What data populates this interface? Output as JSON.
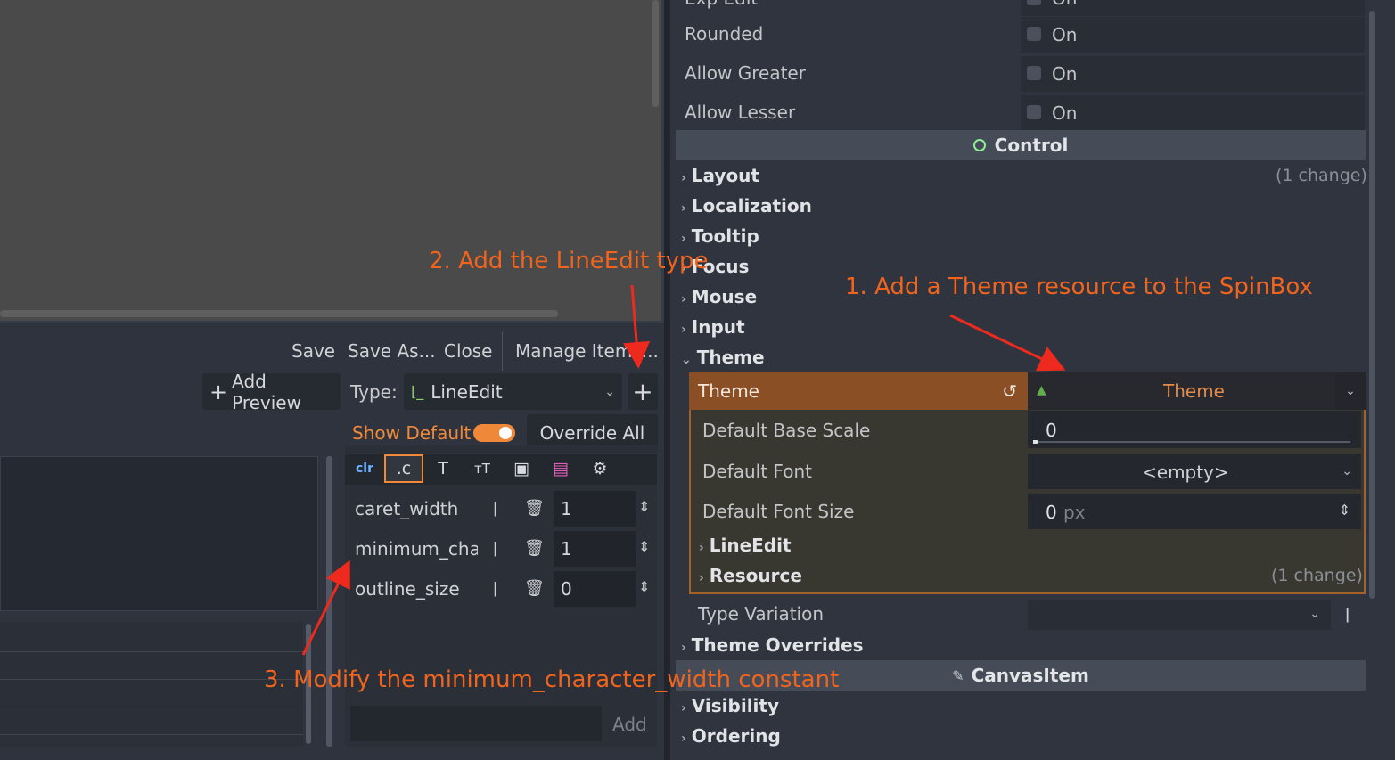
{
  "theme_editor": {
    "menu": {
      "save": "Save",
      "save_as": "Save As...",
      "close": "Close",
      "manage_items": "Manage Items..."
    },
    "add_preview": "Add Preview",
    "type_label": "Type:",
    "type_value": "LineEdit",
    "show_default": "Show Default",
    "override_all": "Override All",
    "constants": [
      {
        "name": "caret_width",
        "value": "1"
      },
      {
        "name": "minimum_char",
        "value": "1"
      },
      {
        "name": "outline_size",
        "value": "0"
      }
    ],
    "add_button": "Add"
  },
  "inspector": {
    "props_top": [
      {
        "label": "Exp Edit",
        "value": "On"
      },
      {
        "label": "Rounded",
        "value": "On"
      },
      {
        "label": "Allow Greater",
        "value": "On"
      },
      {
        "label": "Allow Lesser",
        "value": "On"
      }
    ],
    "control_header": "Control",
    "groups": [
      "Layout",
      "Localization",
      "Tooltip",
      "Focus",
      "Mouse",
      "Input",
      "Theme"
    ],
    "layout_change": "(1 change)",
    "theme_prop": "Theme",
    "theme_value": "Theme",
    "theme_sub": {
      "base_scale_label": "Default Base Scale",
      "base_scale_value": "0",
      "font_label": "Default Font",
      "font_value": "<empty>",
      "font_size_label": "Default Font Size",
      "font_size_value": "0",
      "font_size_unit": "px",
      "lineedit": "LineEdit",
      "resource": "Resource",
      "resource_change": "(1 change)"
    },
    "type_variation": "Type Variation",
    "theme_overrides": "Theme Overrides",
    "canvasitem_header": "CanvasItem",
    "groups_bottom": [
      "Visibility",
      "Ordering"
    ]
  },
  "annotations": {
    "step1": "1. Add a Theme resource to the SpinBox",
    "step2": "2. Add the LineEdit type",
    "step3": "3. Modify the minimum_character_width constant"
  },
  "colors": {
    "accent_orange": "#f0641e",
    "theme_row": "#8a4f24",
    "toggle": "#f0883a"
  }
}
